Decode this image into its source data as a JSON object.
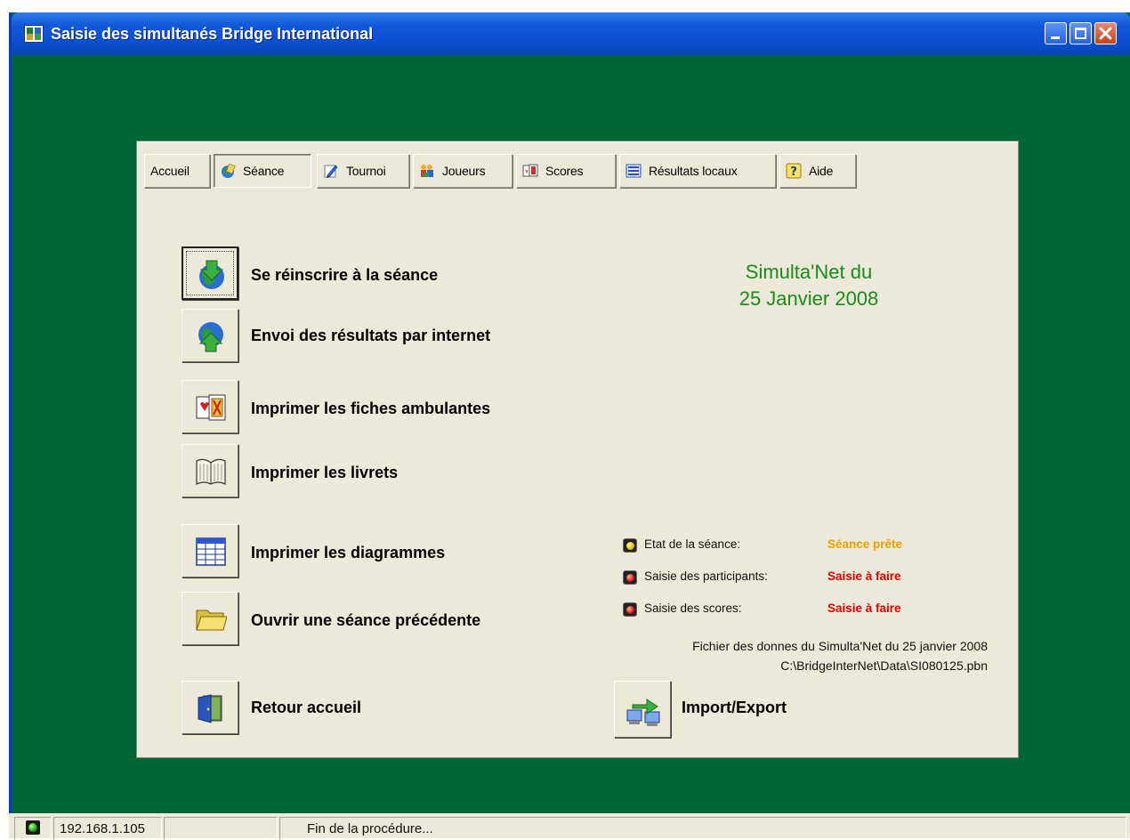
{
  "window": {
    "title": "Saisie des simultanés Bridge International"
  },
  "tabs": [
    {
      "label": "Accueil",
      "icon": "none"
    },
    {
      "label": "Séance",
      "icon": "globe-cards-icon"
    },
    {
      "label": "Tournoi",
      "icon": "pencil-icon"
    },
    {
      "label": "Joueurs",
      "icon": "players-icon"
    },
    {
      "label": "Scores",
      "icon": "scores-cards-icon"
    },
    {
      "label": "Résultats locaux",
      "icon": "list-icon"
    },
    {
      "label": "Aide",
      "icon": "help-icon"
    }
  ],
  "active_tab": "Séance",
  "actions": [
    {
      "label": "Se réinscrire à la séance",
      "icon": "download-globe-icon"
    },
    {
      "label": "Envoi des résultats par internet",
      "icon": "upload-globe-icon"
    },
    {
      "label": "Imprimer les fiches ambulantes",
      "icon": "playing-cards-icon"
    },
    {
      "label": "Imprimer les livrets",
      "icon": "book-icon"
    },
    {
      "label": "Imprimer les diagrammes",
      "icon": "table-grid-icon"
    },
    {
      "label": "Ouvrir une séance précédente",
      "icon": "folder-icon"
    },
    {
      "label": "Retour accueil",
      "icon": "door-icon"
    }
  ],
  "session": {
    "title_line1": "Simulta'Net du",
    "title_line2": "25 Janvier 2008"
  },
  "status": [
    {
      "label": "Etat de la séance:",
      "value": "Séance prête",
      "led": "yellow",
      "value_color": "#f0a000"
    },
    {
      "label": "Saisie des participants:",
      "value": "Saisie à faire",
      "led": "red",
      "value_color": "#e00000"
    },
    {
      "label": "Saisie des scores:",
      "value": "Saisie à faire",
      "led": "red",
      "value_color": "#e00000"
    }
  ],
  "file_info": {
    "line1": "Fichier des donnes du Simulta'Net du 25 janvier 2008",
    "line2": "C:\\BridgeInterNet\\Data\\SI080125.pbn"
  },
  "import_export": {
    "label": "Import/Export",
    "icon": "transfer-icon"
  },
  "statusbar": {
    "ip": "192.168.1.105",
    "message": "Fin de la procédure..."
  },
  "colors": {
    "background": "#006633",
    "panel": "#ece9d8",
    "session_title": "#1a8a1a"
  }
}
